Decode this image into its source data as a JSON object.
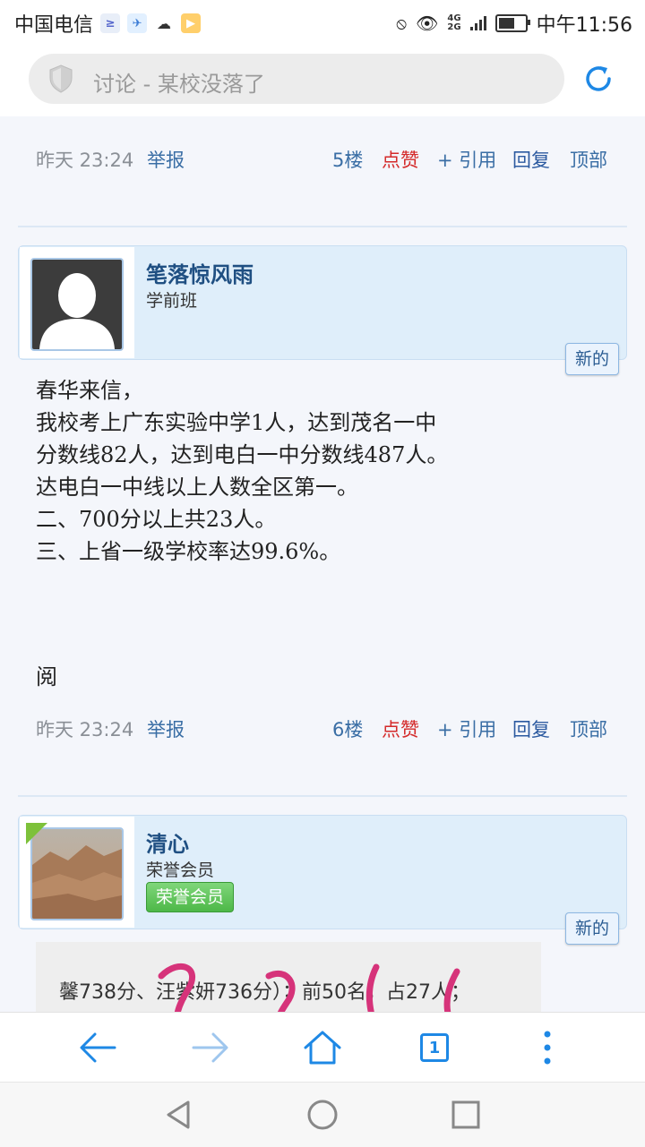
{
  "status_bar": {
    "carrier": "中国电信",
    "clock": "中午11:56",
    "network": [
      "4G",
      "2G"
    ]
  },
  "address_bar": {
    "url_text": "讨论 - 某校没落了"
  },
  "posts": [
    {
      "time": "昨天 23:24",
      "report": "举报",
      "floor": "5楼",
      "like": "点赞",
      "quote": "+ 引用",
      "reply": "回复",
      "top": "顶部"
    },
    {
      "author": "笔落惊风雨",
      "rank": "学前班",
      "new_badge": "新的",
      "body_lines": [
        "春华来信，",
        "我校考上广东实验中学1人，达到茂名一中",
        "分数线82人，达到电白一中分数线487人。",
        "达电白一中线以上人数全区第一。",
        "二、700分以上共23人。",
        "三、上省一级学校率达99.6%。"
      ],
      "body_tail": "阅",
      "time": "昨天 23:24",
      "report": "举报",
      "floor": "6楼",
      "like": "点赞",
      "quote": "+ 引用",
      "reply": "回复",
      "top": "顶部"
    },
    {
      "author": "清心",
      "rank": "荣誉会员",
      "honor_badge": "荣誉会员",
      "new_badge": "新的",
      "quote_lines": [
        "馨738分、汪紫妍736分）；前50名，占27人；"
      ]
    }
  ],
  "icons": {
    "back": "arrow-left-icon",
    "forward": "arrow-right-icon",
    "home": "home-icon",
    "tabs_count": "1",
    "menu": "more-vertical-icon"
  },
  "colors": {
    "link": "#3a6ea5",
    "like": "#d42a2a",
    "card": "#dfeefa",
    "accent": "#1e88e5"
  }
}
